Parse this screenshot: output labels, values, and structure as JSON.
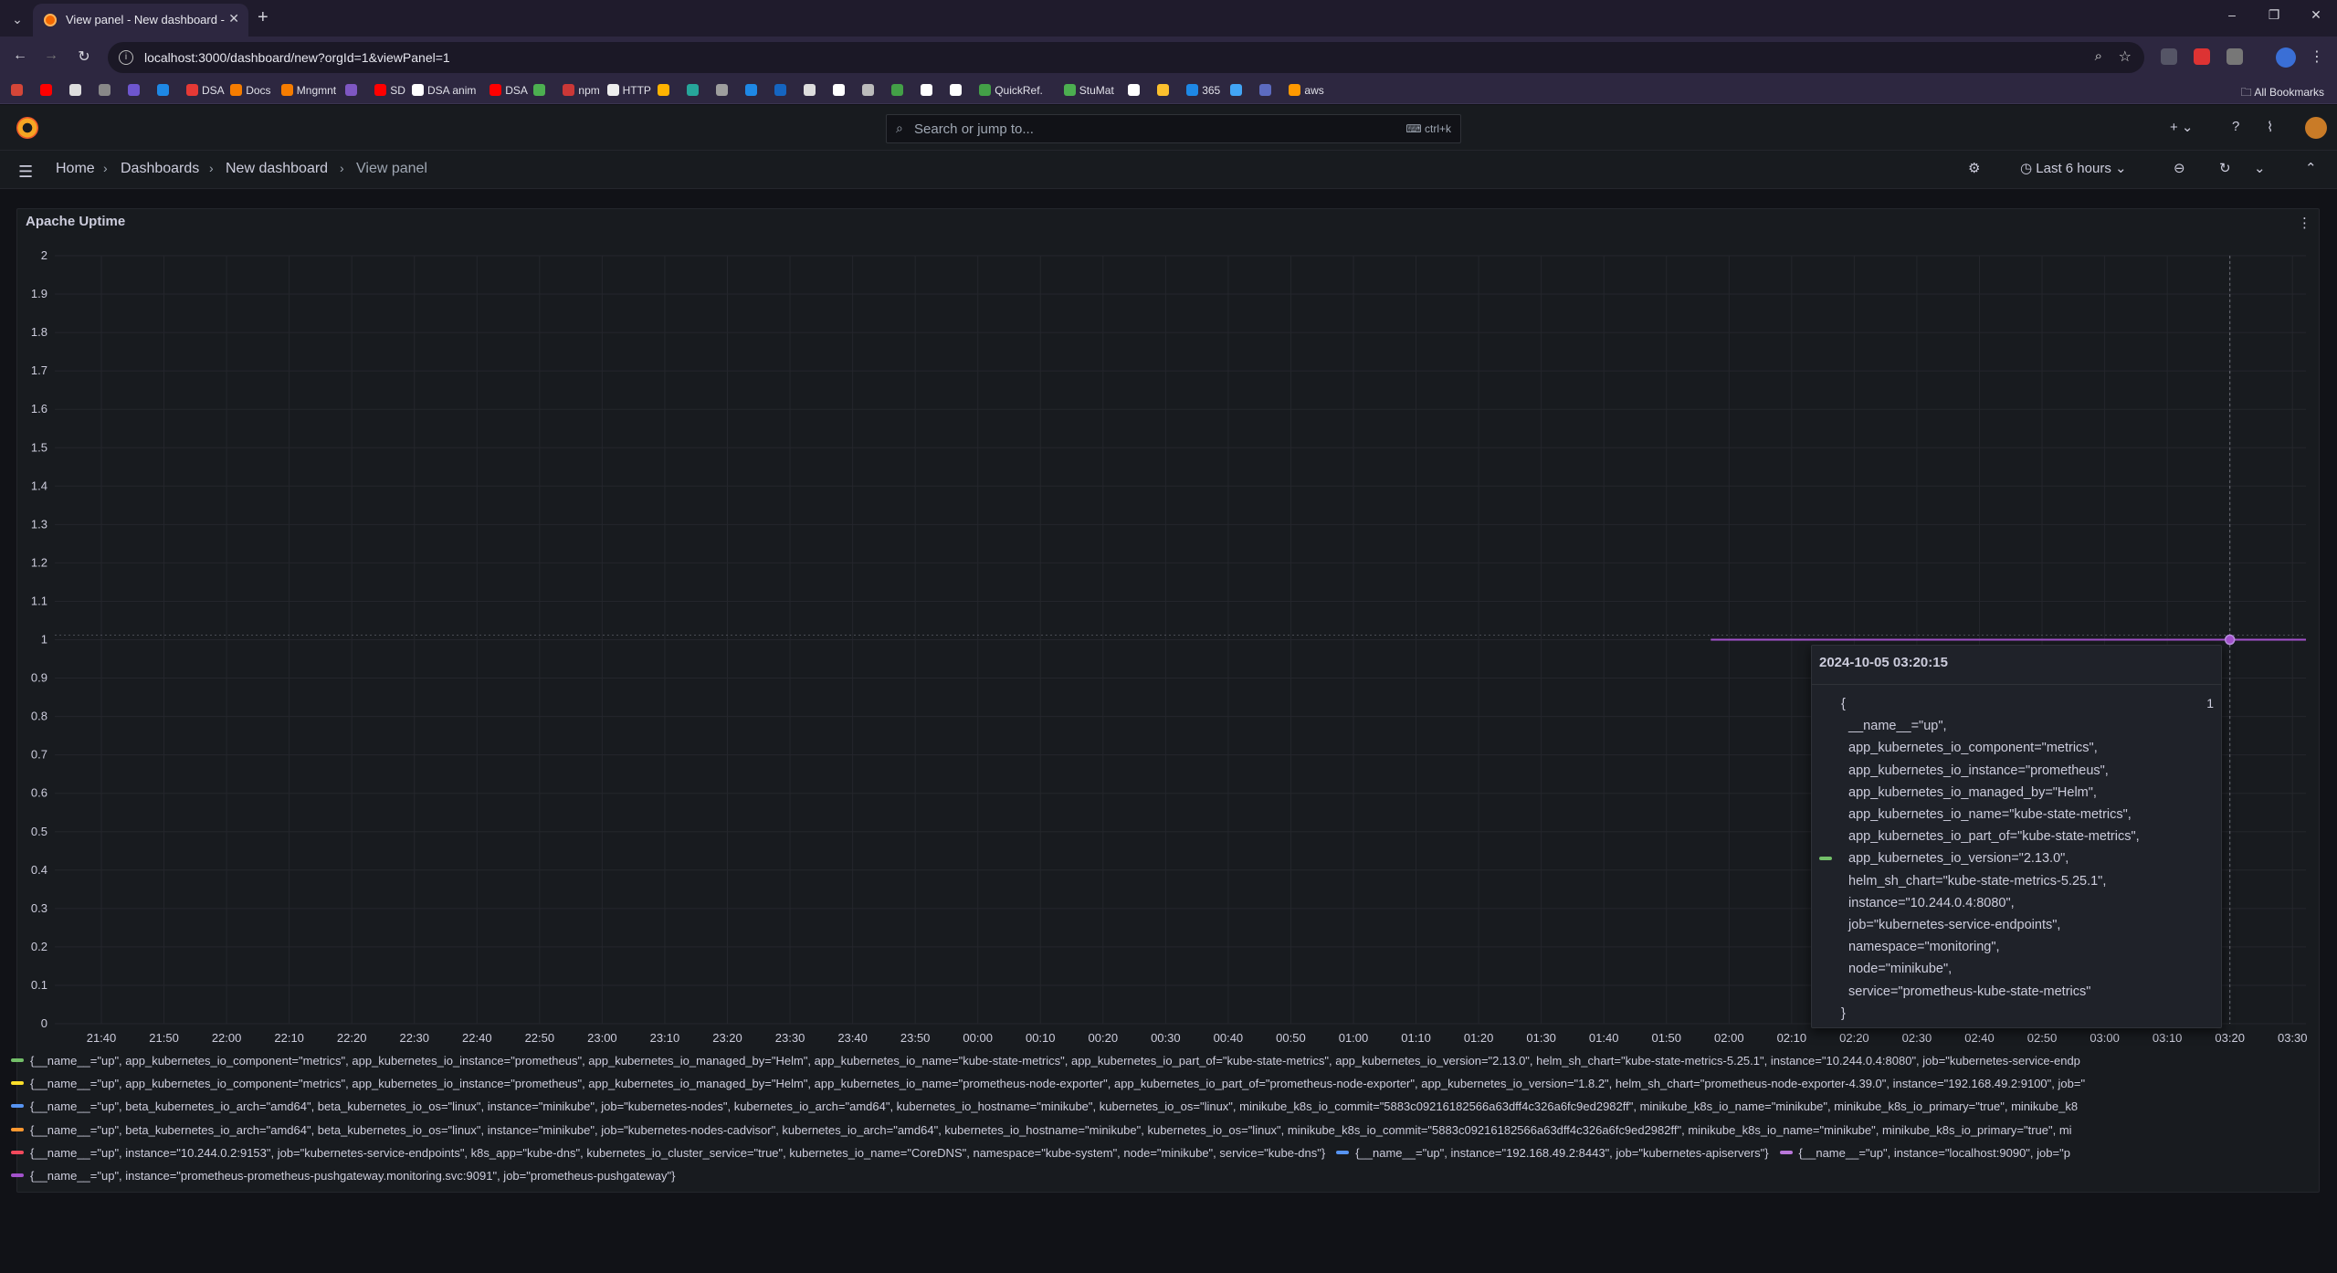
{
  "browser": {
    "tab_title": "View panel - New dashboard -",
    "url": "localhost:3000/dashboard/new?orgId=1&viewPanel=1",
    "bookmarks": [
      {
        "label": "",
        "color": "#d44638"
      },
      {
        "label": "",
        "color": "#ff0000"
      },
      {
        "label": "",
        "color": "#dddddd"
      },
      {
        "label": "",
        "color": "#888888"
      },
      {
        "label": "",
        "color": "#6e56cf"
      },
      {
        "label": "",
        "color": "#1e88e5"
      },
      {
        "label": "DSA",
        "color": "#e53935"
      },
      {
        "label": "Docs",
        "color": "#f57c00"
      },
      {
        "label": "Mngmnt",
        "color": "#f57c00"
      },
      {
        "label": "",
        "color": "#7e57c2"
      },
      {
        "label": "SD",
        "color": "#ff0000"
      },
      {
        "label": "DSA anim",
        "color": "#ffffff"
      },
      {
        "label": "DSA",
        "color": "#ff0000"
      },
      {
        "label": "",
        "color": "#4caf50"
      },
      {
        "label": "npm",
        "color": "#cb3837"
      },
      {
        "label": "HTTP",
        "color": "#eeeeee"
      },
      {
        "label": "",
        "color": "#ffb300"
      },
      {
        "label": "",
        "color": "#26a69a"
      },
      {
        "label": "",
        "color": "#9e9e9e"
      },
      {
        "label": "",
        "color": "#1e88e5"
      },
      {
        "label": "",
        "color": "#1565c0"
      },
      {
        "label": "",
        "color": "#dddddd"
      },
      {
        "label": "",
        "color": "#ffffff"
      },
      {
        "label": "",
        "color": "#bbbbbb"
      },
      {
        "label": "",
        "color": "#43a047"
      },
      {
        "label": "",
        "color": "#ffffff"
      },
      {
        "label": "",
        "color": "#ffffff"
      },
      {
        "label": "QuickRef.",
        "color": "#43a047"
      },
      {
        "label": "StuMat",
        "color": "#4caf50"
      },
      {
        "label": "",
        "color": "#ffffff"
      },
      {
        "label": "",
        "color": "#fbc02d"
      },
      {
        "label": "365",
        "color": "#1e88e5"
      },
      {
        "label": "",
        "color": "#42a5f5"
      },
      {
        "label": "",
        "color": "#5c6bc0"
      },
      {
        "label": "aws",
        "color": "#ff9900"
      }
    ],
    "all_bookmarks": "All Bookmarks"
  },
  "grafana": {
    "search_placeholder": "Search or jump to...",
    "search_shortcut": "ctrl+k",
    "breadcrumbs": [
      "Home",
      "Dashboards",
      "New dashboard",
      "View panel"
    ],
    "time_range": "Last 6 hours"
  },
  "panel": {
    "title": "Apache Uptime"
  },
  "chart_data": {
    "type": "line",
    "title": "Apache Uptime",
    "ylim": [
      0,
      2
    ],
    "yticks": [
      "2",
      "1.9",
      "1.8",
      "1.7",
      "1.6",
      "1.5",
      "1.4",
      "1.3",
      "1.2",
      "1.1",
      "1",
      "0.9",
      "0.8",
      "0.7",
      "0.6",
      "0.5",
      "0.4",
      "0.3",
      "0.2",
      "0.1",
      "0"
    ],
    "xticks": [
      "21:40",
      "21:50",
      "22:00",
      "22:10",
      "22:20",
      "22:30",
      "22:40",
      "22:50",
      "23:00",
      "23:10",
      "23:20",
      "23:30",
      "23:40",
      "23:50",
      "00:00",
      "00:10",
      "00:20",
      "00:30",
      "00:40",
      "00:50",
      "01:00",
      "01:10",
      "01:20",
      "01:30",
      "01:40",
      "01:50",
      "02:00",
      "02:10",
      "02:20",
      "02:30",
      "02:40",
      "02:50",
      "03:00",
      "03:10",
      "03:20",
      "03:30"
    ],
    "grid": true,
    "series": [
      {
        "name": "{__name__=\"up\", instance=\"prometheus-prometheus-pushgateway.monitoring.svc:9091\", job=\"prometheus-pushgateway\"}",
        "color": "#a352cc",
        "x_start": "02:00",
        "x_end": "03:30",
        "value": 1
      }
    ],
    "hover": {
      "x": "03:20",
      "value": 1
    }
  },
  "tooltip": {
    "time": "2024-10-05 03:20:15",
    "value": "1",
    "lines": [
      "{",
      "  __name__=\"up\",",
      "  app_kubernetes_io_component=\"metrics\",",
      "  app_kubernetes_io_instance=\"prometheus\",",
      "  app_kubernetes_io_managed_by=\"Helm\",",
      "  app_kubernetes_io_name=\"kube-state-metrics\",",
      "  app_kubernetes_io_part_of=\"kube-state-metrics\",",
      "  app_kubernetes_io_version=\"2.13.0\",",
      "  helm_sh_chart=\"kube-state-metrics-5.25.1\",",
      "  instance=\"10.244.0.4:8080\",",
      "  job=\"kubernetes-service-endpoints\",",
      "  namespace=\"monitoring\",",
      "  node=\"minikube\",",
      "  service=\"prometheus-kube-state-metrics\"",
      "}"
    ]
  },
  "legend": [
    [
      {
        "color": "#73bf69",
        "text": "{__name__=\"up\", app_kubernetes_io_component=\"metrics\", app_kubernetes_io_instance=\"prometheus\", app_kubernetes_io_managed_by=\"Helm\", app_kubernetes_io_name=\"kube-state-metrics\", app_kubernetes_io_part_of=\"kube-state-metrics\", app_kubernetes_io_version=\"2.13.0\", helm_sh_chart=\"kube-state-metrics-5.25.1\", instance=\"10.244.0.4:8080\", job=\"kubernetes-service-endp"
      }
    ],
    [
      {
        "color": "#fade2a",
        "text": "{__name__=\"up\", app_kubernetes_io_component=\"metrics\", app_kubernetes_io_instance=\"prometheus\", app_kubernetes_io_managed_by=\"Helm\", app_kubernetes_io_name=\"prometheus-node-exporter\", app_kubernetes_io_part_of=\"prometheus-node-exporter\", app_kubernetes_io_version=\"1.8.2\", helm_sh_chart=\"prometheus-node-exporter-4.39.0\", instance=\"192.168.49.2:9100\", job=\""
      }
    ],
    [
      {
        "color": "#5794f2",
        "text": "{__name__=\"up\", beta_kubernetes_io_arch=\"amd64\", beta_kubernetes_io_os=\"linux\", instance=\"minikube\", job=\"kubernetes-nodes\", kubernetes_io_arch=\"amd64\", kubernetes_io_hostname=\"minikube\", kubernetes_io_os=\"linux\", minikube_k8s_io_commit=\"5883c09216182566a63dff4c326a6fc9ed2982ff\", minikube_k8s_io_name=\"minikube\", minikube_k8s_io_primary=\"true\", minikube_k8"
      }
    ],
    [
      {
        "color": "#ff9830",
        "text": "{__name__=\"up\", beta_kubernetes_io_arch=\"amd64\", beta_kubernetes_io_os=\"linux\", instance=\"minikube\", job=\"kubernetes-nodes-cadvisor\", kubernetes_io_arch=\"amd64\", kubernetes_io_hostname=\"minikube\", kubernetes_io_os=\"linux\", minikube_k8s_io_commit=\"5883c09216182566a63dff4c326a6fc9ed2982ff\", minikube_k8s_io_name=\"minikube\", minikube_k8s_io_primary=\"true\", mi"
      }
    ],
    [
      {
        "color": "#f2495c",
        "text": "{__name__=\"up\", instance=\"10.244.0.2:9153\", job=\"kubernetes-service-endpoints\", k8s_app=\"kube-dns\", kubernetes_io_cluster_service=\"true\", kubernetes_io_name=\"CoreDNS\", namespace=\"kube-system\", node=\"minikube\", service=\"kube-dns\"}"
      },
      {
        "color": "#5794f2",
        "text": "{__name__=\"up\", instance=\"192.168.49.2:8443\", job=\"kubernetes-apiservers\"}"
      },
      {
        "color": "#b877d9",
        "text": "{__name__=\"up\", instance=\"localhost:9090\", job=\"p"
      }
    ],
    [
      {
        "color": "#a352cc",
        "text": "{__name__=\"up\", instance=\"prometheus-prometheus-pushgateway.monitoring.svc:9091\", job=\"prometheus-pushgateway\"}"
      }
    ]
  ]
}
